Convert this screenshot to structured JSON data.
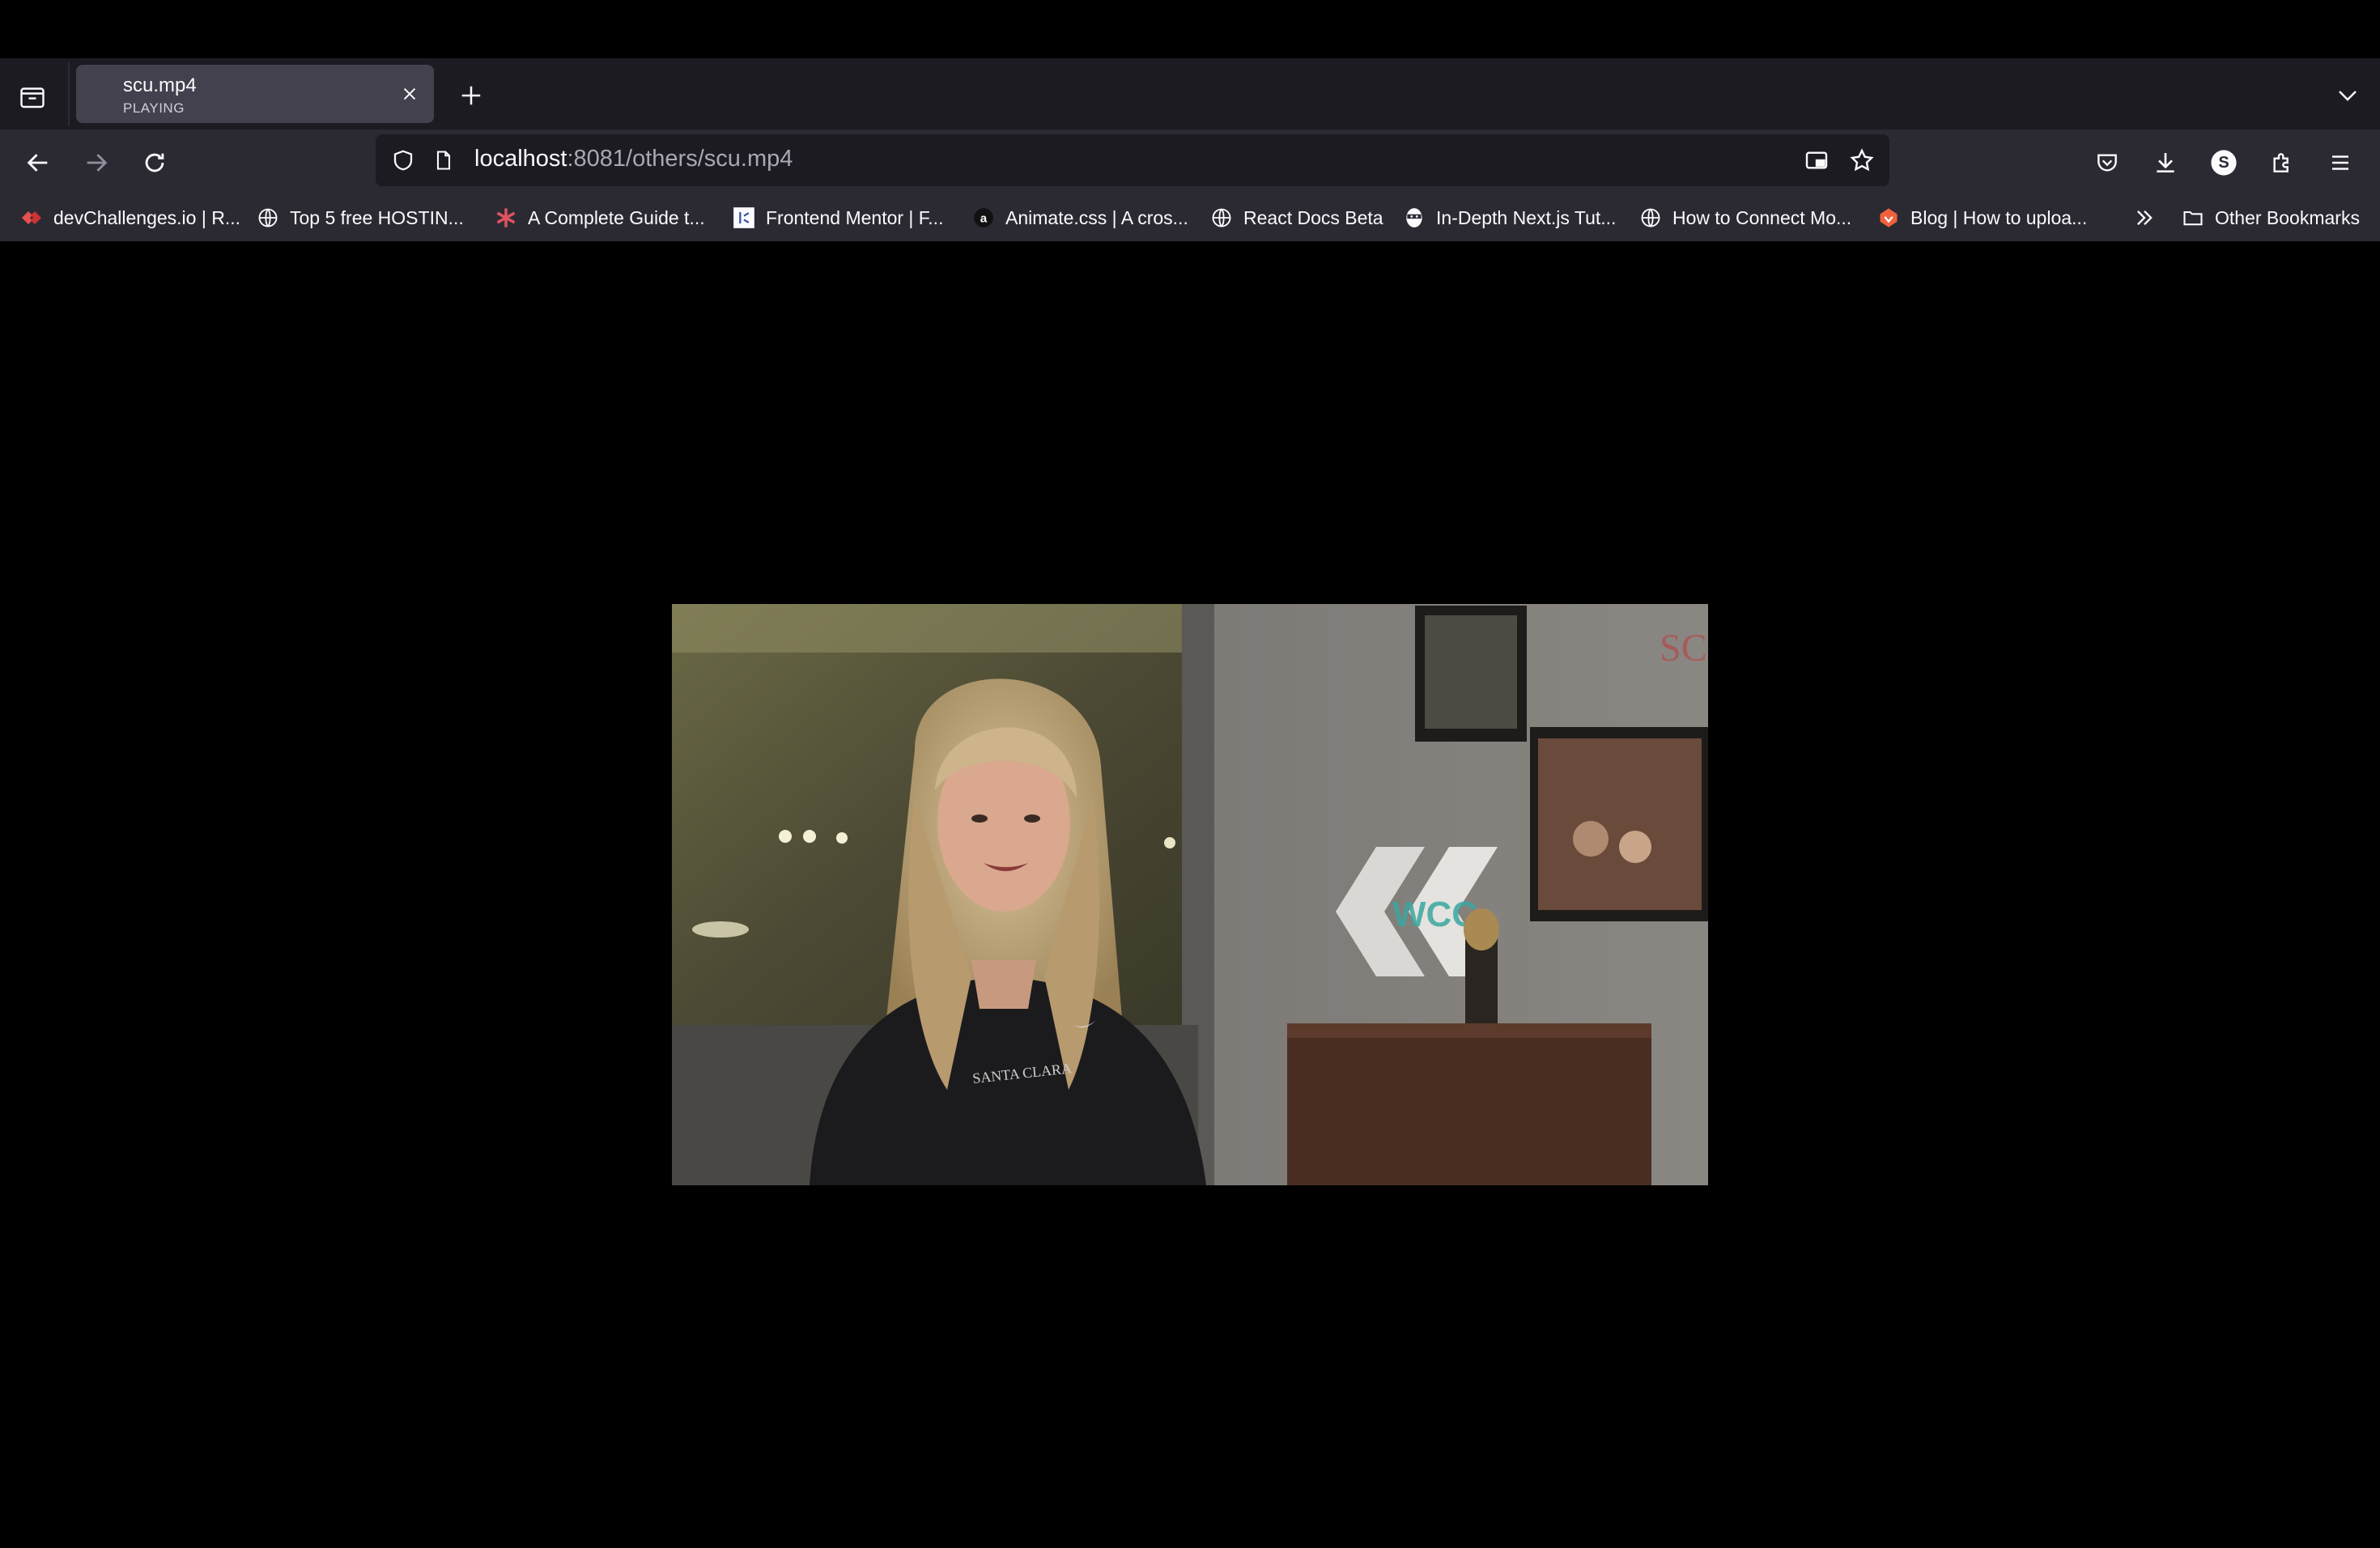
{
  "tab": {
    "title": "scu.mp4",
    "status": "PLAYING"
  },
  "urlbar": {
    "host": "localhost",
    "rest": ":8081/others/scu.mp4"
  },
  "bookmarks": [
    {
      "label": "devChallenges.io | R...",
      "icon": "devchallenges-icon"
    },
    {
      "label": "Top 5 free HOSTIN...",
      "icon": "globe-icon"
    },
    {
      "label": "A Complete Guide t...",
      "icon": "asterisk-icon"
    },
    {
      "label": "Frontend Mentor | F...",
      "icon": "frontend-mentor-icon"
    },
    {
      "label": "Animate.css | A cros...",
      "icon": "animate-icon"
    },
    {
      "label": "React Docs Beta",
      "icon": "globe-icon"
    },
    {
      "label": "In-Depth Next.js Tut...",
      "icon": "ninja-icon"
    },
    {
      "label": "How to Connect Mo...",
      "icon": "globe-icon"
    },
    {
      "label": "Blog | How to uploa...",
      "icon": "blog-icon"
    }
  ],
  "other_bookmarks": "Other Bookmarks",
  "account_initial": "S",
  "video": {
    "watermark": "SC",
    "banner": "WCC",
    "shirt": "SANTA CLARA"
  },
  "colors": {
    "chrome": "#2b2a33",
    "tabstrip": "#1c1b22",
    "active_tab": "#42414d",
    "text": "#fbfbfe"
  }
}
